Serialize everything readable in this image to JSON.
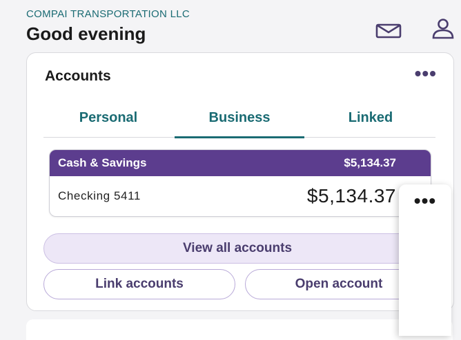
{
  "header": {
    "company": "COMPAI TRANSPORTATION LLC",
    "greeting": "Good evening",
    "icons": {
      "mail": "mail-icon",
      "profile": "user-icon"
    }
  },
  "accounts": {
    "title": "Accounts",
    "more": "•••",
    "tabs": [
      {
        "label": "Personal",
        "selected": false
      },
      {
        "label": "Business",
        "selected": true
      },
      {
        "label": "Linked",
        "selected": false
      }
    ],
    "group": {
      "name": "Cash & Savings",
      "total": "$5,134.37"
    },
    "items": [
      {
        "name": "Checking 5411",
        "balance": "$5,134.37"
      }
    ],
    "buttons": {
      "view_all": "View all accounts",
      "link": "Link accounts",
      "open": "Open account"
    }
  },
  "popup": {
    "more": "•••"
  },
  "colors": {
    "teal": "#1a6b73",
    "purple": "#5c3d8e",
    "purple_text": "#4a3d6e",
    "lavender": "#ede7f7"
  }
}
